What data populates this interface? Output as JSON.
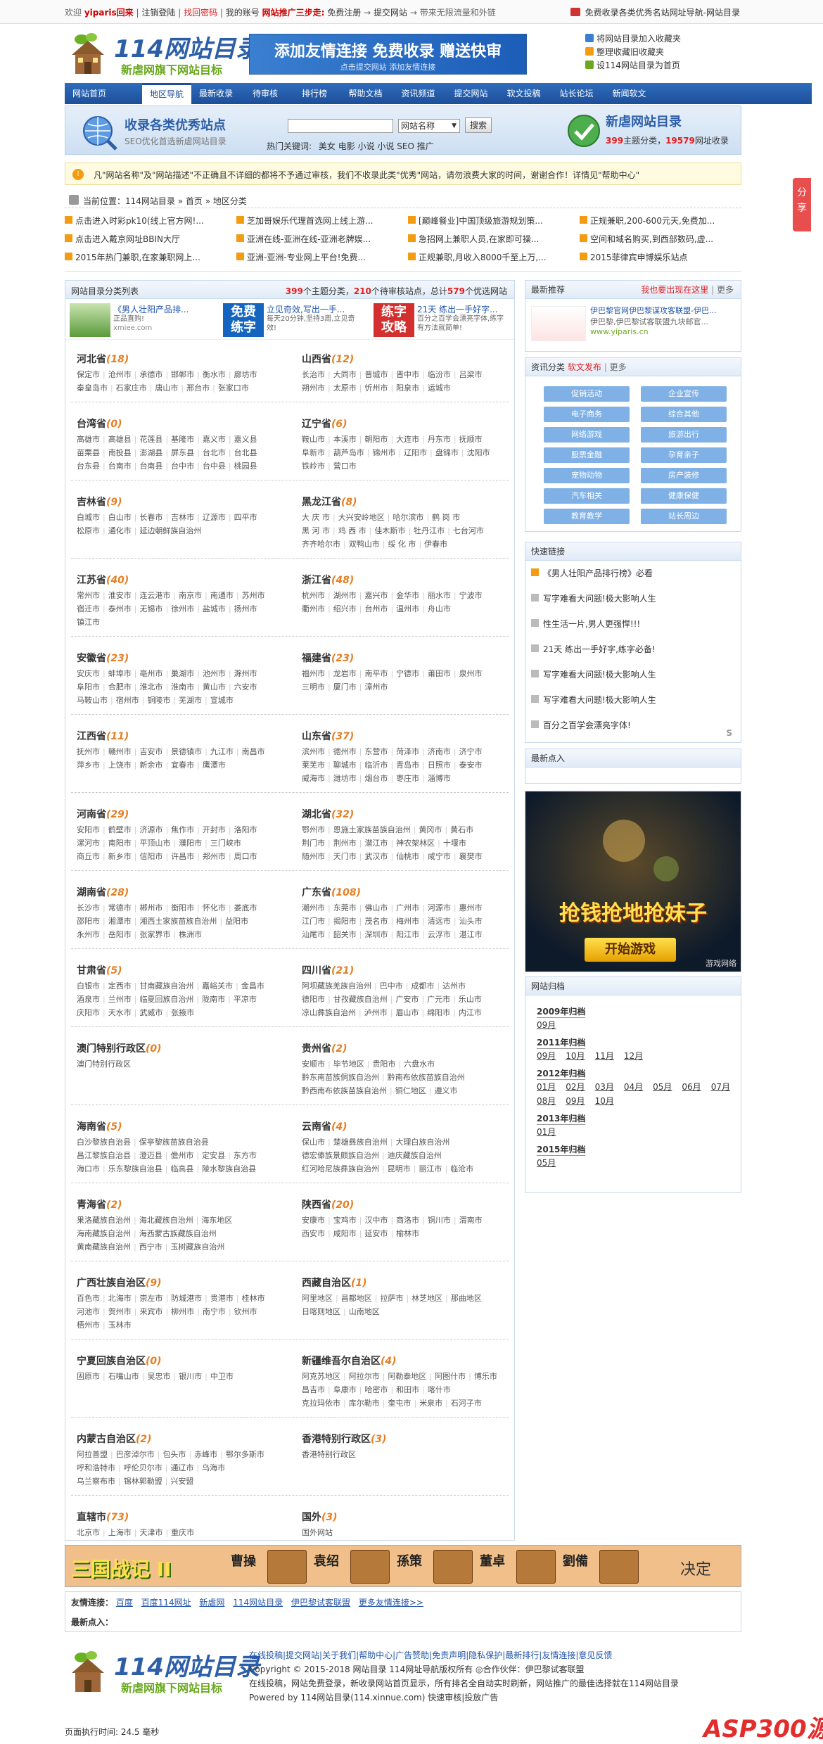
{
  "topbar": {
    "welcome": "欢迎",
    "user": "yiparis回来",
    "sep1": "|",
    "logout": "注销登陆",
    "sep2": "|",
    "find_pw": "找回密码",
    "sep3": "|",
    "account": "我的账号",
    "promo": "网站推广三步走:",
    "step1": "免费注册",
    "arrow1": "→",
    "step2": "提交网站",
    "arrow2": "→",
    "step3": "带来无限流量和外链",
    "right_text": "免费收录各类优秀名站网址导航-网站目录"
  },
  "header": {
    "logo_main": "114网站目录",
    "logo_sub": "新虐网旗下网站目标",
    "banner_title": "添加友情连接 免费收录 赠送快审",
    "banner_sub": "点击提交网站 添加友情连接",
    "links": [
      "将网站目录加入收藏夹",
      "整理收藏旧收藏夹",
      "设114网站目录为首页"
    ]
  },
  "nav": [
    "网站首页",
    "地区导航",
    "最新收录",
    "待审核",
    "排行榜",
    "帮助文档",
    "资讯频道",
    "提交网站",
    "软文投稿",
    "站长论坛",
    "新闻软文"
  ],
  "nav_active": 1,
  "search": {
    "title": "收录各类优秀站点",
    "subtitle": "SEO优化首选新虐网站目录",
    "input": "",
    "select": "网站名称",
    "button": "搜索",
    "hot_label": "热门关键词:",
    "hot": [
      "美女",
      "电影",
      "小说",
      "小说",
      "SEO",
      "推广"
    ],
    "right_title": "新虐网站目录",
    "right_count_label": "主题分类，",
    "right_sites_label": "网址收录",
    "count": "399",
    "sites": "19579"
  },
  "notice": "凡\"网站名称\"及\"网站描述\"不正确且不详细的都将不予通过审核，我们不收录此类\"优秀\"网站，请勿浪费大家的时间，谢谢合作！详情见\"帮助中心\"",
  "crumb": "当前位置：114网站目录 » 首页 » 地区分类",
  "ticker": [
    "点击进入时彩pk10(线上官方网!...",
    "芝加哥娱乐代理首选网上线上游...",
    "[巅峰餐业]中国顶级旅游规划策...",
    "正规兼职,200-600元天,免费加...",
    "点击进入戴京网址BBIN大厅",
    "亚洲在线-亚洲在线-亚洲老牌娱...",
    "急招网上兼职人员,在家即可操...",
    "空间和域名购买,到西部数码,虚...",
    "2015年热门兼职,在家兼职网上...",
    "亚洲-亚洲-专业网上平台!免费...",
    "正规兼职,月收入8000千至上万,...",
    "2015菲律宾申博娱乐站点"
  ],
  "main": {
    "head_left": "网站目录分类列表",
    "count": "399",
    "count_label": "个主题分类，",
    "pending": "210",
    "pending_label": "个待审核站点，总计",
    "total": "579",
    "total_label": "个优选网站",
    "ads": [
      {
        "title": "《男人壮阳产品排...",
        "desc": "正品直购!",
        "url": "xmiee.com"
      },
      {
        "title": "立见奇效,写出一手...",
        "desc": "每天20分钟,坚持3周,立见奇效!"
      },
      {
        "title": "21天 练出一手好字...",
        "desc": "百分之百学会漂亮字体,练字有方法就简单!"
      }
    ]
  },
  "provinces": [
    {
      "name": "河北省",
      "count": "(18)",
      "rows": [
        [
          "保定市",
          "沧州市",
          "承德市",
          "邯郸市",
          "衡水市",
          "廊坊市"
        ],
        [
          "秦皇岛市",
          "石家庄市",
          "唐山市",
          "邢台市",
          "张家口市"
        ]
      ]
    },
    {
      "name": "山西省",
      "count": "(12)",
      "rows": [
        [
          "长治市",
          "大同市",
          "晋城市",
          "晋中市",
          "临汾市",
          "吕梁市"
        ],
        [
          "朔州市",
          "太原市",
          "忻州市",
          "阳泉市",
          "运城市"
        ]
      ]
    },
    {
      "name": "台湾省",
      "count": "(0)",
      "rows": [
        [
          "高雄市",
          "高雄县",
          "花莲县",
          "基隆市",
          "嘉义市",
          "嘉义县"
        ],
        [
          "苗栗县",
          "南投县",
          "澎湖县",
          "屏东县",
          "台北市",
          "台北县"
        ],
        [
          "台东县",
          "台南市",
          "台南县",
          "台中市",
          "台中县",
          "桃园县"
        ]
      ]
    },
    {
      "name": "辽宁省",
      "count": "(6)",
      "rows": [
        [
          "鞍山市",
          "本溪市",
          "朝阳市",
          "大连市",
          "丹东市",
          "抚顺市"
        ],
        [
          "阜新市",
          "葫芦岛市",
          "锦州市",
          "辽阳市",
          "盘锦市",
          "沈阳市"
        ],
        [
          "铁岭市",
          "营口市"
        ]
      ]
    },
    {
      "name": "吉林省",
      "count": "(9)",
      "rows": [
        [
          "白城市",
          "白山市",
          "长春市",
          "吉林市",
          "辽源市",
          "四平市"
        ],
        [
          "松原市",
          "通化市",
          "延边朝鲜族自治州"
        ]
      ]
    },
    {
      "name": "黑龙江省",
      "count": "(8)",
      "rows": [
        [
          "大 庆 市",
          "大兴安岭地区",
          "哈尔滨市",
          "鹤 岗 市"
        ],
        [
          "黑 河 市",
          "鸡 西 市",
          "佳木斯市",
          "牡丹江市",
          "七台河市"
        ],
        [
          "齐齐哈尔市",
          "双鸭山市",
          "绥 化 市",
          "伊春市"
        ]
      ]
    },
    {
      "name": "江苏省",
      "count": "(40)",
      "rows": [
        [
          "常州市",
          "淮安市",
          "连云港市",
          "南京市",
          "南通市",
          "苏州市"
        ],
        [
          "宿迁市",
          "泰州市",
          "无锡市",
          "徐州市",
          "盐城市",
          "扬州市"
        ],
        [
          "镇江市"
        ]
      ]
    },
    {
      "name": "浙江省",
      "count": "(48)",
      "rows": [
        [
          "杭州市",
          "湖州市",
          "嘉兴市",
          "金华市",
          "丽水市",
          "宁波市"
        ],
        [
          "衢州市",
          "绍兴市",
          "台州市",
          "温州市",
          "舟山市"
        ]
      ]
    },
    {
      "name": "安徽省",
      "count": "(23)",
      "rows": [
        [
          "安庆市",
          "蚌埠市",
          "亳州市",
          "巢湖市",
          "池州市",
          "滁州市"
        ],
        [
          "阜阳市",
          "合肥市",
          "淮北市",
          "淮南市",
          "黄山市",
          "六安市"
        ],
        [
          "马鞍山市",
          "宿州市",
          "铜陵市",
          "芜湖市",
          "宣城市"
        ]
      ]
    },
    {
      "name": "福建省",
      "count": "(23)",
      "rows": [
        [
          "福州市",
          "龙岩市",
          "南平市",
          "宁德市",
          "莆田市",
          "泉州市"
        ],
        [
          "三明市",
          "厦门市",
          "漳州市"
        ]
      ]
    },
    {
      "name": "江西省",
      "count": "(11)",
      "rows": [
        [
          "抚州市",
          "赣州市",
          "吉安市",
          "景德镇市",
          "九江市",
          "南昌市"
        ],
        [
          "萍乡市",
          "上饶市",
          "新余市",
          "宜春市",
          "鹰潭市"
        ]
      ]
    },
    {
      "name": "山东省",
      "count": "(37)",
      "rows": [
        [
          "滨州市",
          "德州市",
          "东营市",
          "菏泽市",
          "济南市",
          "济宁市"
        ],
        [
          "莱芜市",
          "聊城市",
          "临沂市",
          "青岛市",
          "日照市",
          "泰安市"
        ],
        [
          "威海市",
          "潍坊市",
          "烟台市",
          "枣庄市",
          "淄博市"
        ]
      ]
    },
    {
      "name": "河南省",
      "count": "(29)",
      "rows": [
        [
          "安阳市",
          "鹤壁市",
          "济源市",
          "焦作市",
          "开封市",
          "洛阳市"
        ],
        [
          "漯河市",
          "南阳市",
          "平顶山市",
          "濮阳市",
          "三门峡市"
        ],
        [
          "商丘市",
          "新乡市",
          "信阳市",
          "许昌市",
          "郑州市",
          "周口市"
        ]
      ]
    },
    {
      "name": "湖北省",
      "count": "(32)",
      "rows": [
        [
          "鄂州市",
          "恩施土家族苗族自治州",
          "黄冈市",
          "黄石市"
        ],
        [
          "荆门市",
          "荆州市",
          "潜江市",
          "神农架林区",
          "十堰市"
        ],
        [
          "随州市",
          "天门市",
          "武汉市",
          "仙桃市",
          "咸宁市",
          "襄樊市"
        ]
      ]
    },
    {
      "name": "湖南省",
      "count": "(28)",
      "rows": [
        [
          "长沙市",
          "常德市",
          "郴州市",
          "衡阳市",
          "怀化市",
          "娄底市"
        ],
        [
          "邵阳市",
          "湘潭市",
          "湘西土家族苗族自治州",
          "益阳市"
        ],
        [
          "永州市",
          "岳阳市",
          "张家界市",
          "株洲市"
        ]
      ]
    },
    {
      "name": "广东省",
      "count": "(108)",
      "rows": [
        [
          "潮州市",
          "东莞市",
          "佛山市",
          "广州市",
          "河源市",
          "惠州市"
        ],
        [
          "江门市",
          "揭阳市",
          "茂名市",
          "梅州市",
          "清远市",
          "汕头市"
        ],
        [
          "汕尾市",
          "韶关市",
          "深圳市",
          "阳江市",
          "云浮市",
          "湛江市"
        ]
      ]
    },
    {
      "name": "甘肃省",
      "count": "(5)",
      "rows": [
        [
          "白银市",
          "定西市",
          "甘南藏族自治州",
          "嘉峪关市",
          "金昌市"
        ],
        [
          "酒泉市",
          "兰州市",
          "临夏回族自治州",
          "陇南市",
          "平凉市"
        ],
        [
          "庆阳市",
          "天水市",
          "武威市",
          "张掖市"
        ]
      ]
    },
    {
      "name": "四川省",
      "count": "(21)",
      "rows": [
        [
          "阿坝藏族羌族自治州",
          "巴中市",
          "成都市",
          "达州市"
        ],
        [
          "德阳市",
          "甘孜藏族自治州",
          "广安市",
          "广元市",
          "乐山市"
        ],
        [
          "凉山彝族自治州",
          "泸州市",
          "眉山市",
          "绵阳市",
          "内江市"
        ]
      ]
    },
    {
      "name": "澳门特别行政区",
      "count": "(0)",
      "rows": [
        [
          "澳门特别行政区"
        ]
      ]
    },
    {
      "name": "贵州省",
      "count": "(2)",
      "rows": [
        [
          "安顺市",
          "毕节地区",
          "贵阳市",
          "六盘水市"
        ],
        [
          "黔东南苗族侗族自治州",
          "黔南布依族苗族自治州"
        ],
        [
          "黔西南布依族苗族自治州",
          "铜仁地区",
          "遵义市"
        ]
      ]
    },
    {
      "name": "海南省",
      "count": "(5)",
      "rows": [
        [
          "白沙黎族自治县",
          "保亭黎族苗族自治县"
        ],
        [
          "昌江黎族自治县",
          "澄迈县",
          "儋州市",
          "定安县",
          "东方市"
        ],
        [
          "海口市",
          "乐东黎族自治县",
          "临高县",
          "陵水黎族自治县"
        ]
      ]
    },
    {
      "name": "云南省",
      "count": "(4)",
      "rows": [
        [
          "保山市",
          "楚雄彝族自治州",
          "大理白族自治州"
        ],
        [
          "德宏傣族景颇族自治州",
          "迪庆藏族自治州"
        ],
        [
          "红河哈尼族彝族自治州",
          "昆明市",
          "丽江市",
          "临沧市"
        ]
      ]
    },
    {
      "name": "青海省",
      "count": "(2)",
      "rows": [
        [
          "果洛藏族自治州",
          "海北藏族自治州",
          "海东地区"
        ],
        [
          "海南藏族自治州",
          "海西蒙古族藏族自治州"
        ],
        [
          "黄南藏族自治州",
          "西宁市",
          "玉树藏族自治州"
        ]
      ]
    },
    {
      "name": "陕西省",
      "count": "(20)",
      "rows": [
        [
          "安康市",
          "宝鸡市",
          "汉中市",
          "商洛市",
          "铜川市",
          "渭南市"
        ],
        [
          "西安市",
          "咸阳市",
          "延安市",
          "榆林市"
        ]
      ]
    },
    {
      "name": "广西壮族自治区",
      "count": "(9)",
      "rows": [
        [
          "百色市",
          "北海市",
          "崇左市",
          "防城港市",
          "贵港市",
          "桂林市"
        ],
        [
          "河池市",
          "贺州市",
          "来宾市",
          "柳州市",
          "南宁市",
          "钦州市"
        ],
        [
          "梧州市",
          "玉林市"
        ]
      ]
    },
    {
      "name": "西藏自治区",
      "count": "(1)",
      "rows": [
        [
          "阿里地区",
          "昌都地区",
          "拉萨市",
          "林芝地区",
          "那曲地区"
        ],
        [
          "日喀则地区",
          "山南地区"
        ]
      ]
    },
    {
      "name": "宁夏回族自治区",
      "count": "(0)",
      "rows": [
        [
          "固原市",
          "石嘴山市",
          "吴忠市",
          "银川市",
          "中卫市"
        ]
      ]
    },
    {
      "name": "新疆维吾尔自治区",
      "count": "(4)",
      "rows": [
        [
          "阿克苏地区",
          "阿拉尔市",
          "阿勒泰地区",
          "阿图什市",
          "博乐市"
        ],
        [
          "昌吉市",
          "阜康市",
          "哈密市",
          "和田市",
          "喀什市"
        ],
        [
          "克拉玛依市",
          "库尔勒市",
          "奎屯市",
          "米泉市",
          "石河子市"
        ]
      ]
    },
    {
      "name": "内蒙古自治区",
      "count": "(2)",
      "rows": [
        [
          "阿拉善盟",
          "巴彦淖尔市",
          "包头市",
          "赤峰市",
          "鄂尔多斯市"
        ],
        [
          "呼和浩特市",
          "呼伦贝尔市",
          "通辽市",
          "乌海市"
        ],
        [
          "乌兰察布市",
          "锡林郭勒盟",
          "兴安盟"
        ]
      ]
    },
    {
      "name": "香港特别行政区",
      "count": "(3)",
      "rows": [
        [
          "香港特别行政区"
        ]
      ]
    },
    {
      "name": "直辖市",
      "count": "(73)",
      "rows": [
        [
          "北京市",
          "上海市",
          "天津市",
          "重庆市"
        ]
      ]
    },
    {
      "name": "国外",
      "count": "(3)",
      "rows": [
        [
          "国外网站"
        ]
      ]
    }
  ],
  "right": {
    "rec_title": "最新推荐",
    "rec_more": "我也要出现在这里",
    "rec_pipe": "|",
    "rec_more2": "更多",
    "rec_site": "伊巴黎官网伊巴黎谋攻客联盟-伊巴...",
    "rec_desc": "伊巴黎,伊巴黎试客联盟九块邮官...",
    "rec_url": "www.yiparis.cn",
    "cat_title": "资讯分类",
    "cat_sub": "软文发布",
    "cat_pipe": "|",
    "cat_more": "更多",
    "cats": [
      "促销活动",
      "企业宣传",
      "电子商务",
      "综合其他",
      "网络游戏",
      "旅游出行",
      "股票金融",
      "孕育亲子",
      "宠物动物",
      "房产装修",
      "汽车相关",
      "健康保健",
      "教育教学",
      "站长周边"
    ],
    "quick_title": "快速链接",
    "quick": [
      "《男人壮阳产品排行榜》必看",
      "写字难看大问题!极大影响人生",
      "性生活一片,男人更强悍!!!",
      "21天 练出一手好字,练字必备!",
      "写字难看大问题!极大影响人生",
      "写字难看大问题!极大影响人生",
      "百分之百学会漂亮字体!"
    ],
    "latest_title": "最新点入",
    "game_title": "抢钱抢地抢妹子",
    "game_btn": "开始游戏",
    "game_brand": "游戏网络",
    "arch_title": "网站归档",
    "archives": [
      {
        "year": "2009年归档",
        "months": [
          "09月"
        ]
      },
      {
        "year": "2011年归档",
        "months": [
          "09月",
          "10月",
          "11月",
          "12月"
        ]
      },
      {
        "year": "2012年归档",
        "months": [
          "01月",
          "02月",
          "03月",
          "04月",
          "05月",
          "06月",
          "07月",
          "08月",
          "09月",
          "10月"
        ]
      },
      {
        "year": "2013年归档",
        "months": [
          "01月"
        ]
      },
      {
        "year": "2015年归档",
        "months": [
          "05月"
        ]
      }
    ]
  },
  "bottom_banner": {
    "game": "三国战记 II",
    "names": [
      "曹操",
      "袁绍",
      "孫策",
      "董卓",
      "劉備"
    ],
    "confirm": "决定"
  },
  "friends": {
    "label": "友情连接：",
    "links": [
      "百度",
      "百度114网址",
      "新虐网",
      "114网站目录",
      "伊巴黎试客联盟",
      "更多友情连接>>"
    ],
    "latest": "最新点入："
  },
  "footer": {
    "links": "在线投稿|提交网站|关于我们|帮助中心|广告赞助|免责声明|隐私保护|最新排行|友情连接|意见反馈",
    "copyright": "Copyright © 2015-2018  网站目录  114网址导航版权所有  ◎合作伙伴：伊巴黎试客联盟",
    "desc": "在线投稿，网站免费登录，新收录网站首页显示，所有排名全自动实时刷新，网站推广的最佳选择就在114网站目录",
    "powered": "Powered by 114网站目录(114.xinnue.com)  快速审核|投放广告"
  },
  "exec": "页面执行时间: 24.5 毫秒",
  "side_tab": "分享",
  "asp_logo": "ASP300源码"
}
